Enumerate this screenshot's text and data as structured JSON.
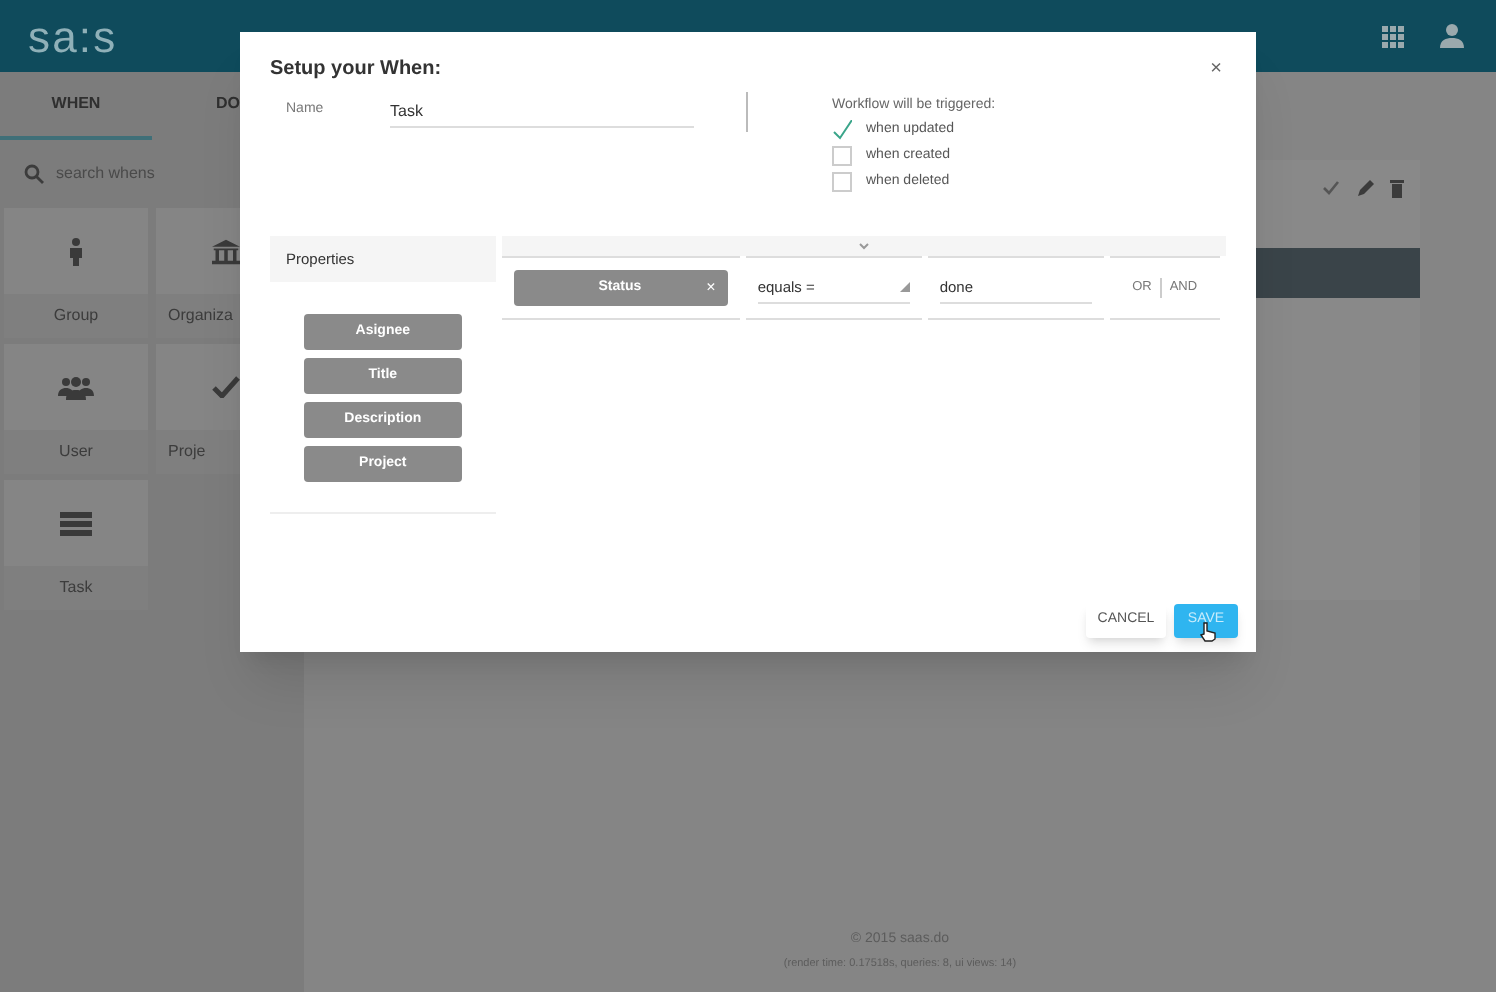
{
  "app": {
    "logo": "sa:s",
    "tabs": [
      {
        "label": "WHEN",
        "selected": true
      },
      {
        "label": "DO",
        "selected": false
      }
    ],
    "search": {
      "placeholder": "search whens"
    },
    "tiles": [
      {
        "label": "Group"
      },
      {
        "label": "Organiza"
      },
      {
        "label": "User"
      },
      {
        "label": "Proje"
      },
      {
        "label": "Task"
      }
    ],
    "footer": {
      "copyright": "© 2015 saas.do",
      "stats": "(render time: 0.17518s, queries: 8, ui views: 14)"
    }
  },
  "dialog": {
    "title": "Setup your When:",
    "close": "×",
    "name": {
      "label": "Name",
      "value": "Task"
    },
    "trigger": {
      "heading": "Workflow will be triggered:",
      "options": [
        {
          "label": "when updated",
          "checked": true
        },
        {
          "label": "when created",
          "checked": false
        },
        {
          "label": "when deleted",
          "checked": false
        }
      ]
    },
    "properties": {
      "heading": "Properties",
      "items": [
        "Asignee",
        "Title",
        "Description",
        "Project"
      ]
    },
    "condition": {
      "property": "Status",
      "remove": "×",
      "operator": "equals =",
      "value": "done",
      "joins": [
        "OR",
        "AND"
      ]
    },
    "buttons": [
      {
        "label": "CANCEL",
        "kind": "flat"
      },
      {
        "label": "SAVE",
        "kind": "primary"
      }
    ]
  }
}
